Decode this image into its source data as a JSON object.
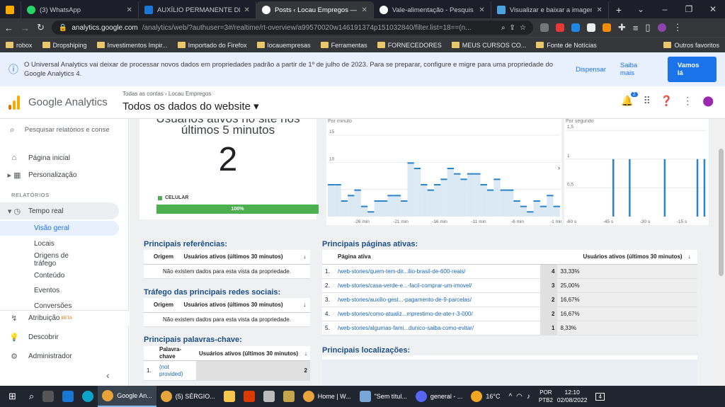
{
  "browser": {
    "tabs": [
      {
        "title": "",
        "color": "#f9ab00"
      },
      {
        "title": "(3) WhatsApp",
        "color": "#25d366"
      },
      {
        "title": "AUXÍLIO PERMANENTE DE...",
        "color": "#1976d2"
      },
      {
        "title": "Posts ‹ Locau Empregos —",
        "color": "#ffffff"
      },
      {
        "title": "Vale-alimentação - Pesquis",
        "color": "#ffffff"
      },
      {
        "title": "Visualizar e baixar a imagem",
        "color": "#4aa3df"
      }
    ],
    "new_tab": "+",
    "url_main": "analytics.google.com",
    "url_rest": "/analytics/web/?authuser=3#/realtime/rt-overview/a99570020w146191374p151032840/filter.list=18==(n...",
    "bookmarks": [
      "robox",
      "Dropshiping",
      "Investimentos Impir...",
      "Importado do Firefox",
      "locauempresas",
      "Ferramentas",
      "FORNECEDORES",
      "MEUS CURSOS CO...",
      "Fonte de Notícias"
    ],
    "bookmarks_other": "Outros favoritos"
  },
  "banner": {
    "message": "O Universal Analytics vai deixar de processar novos dados em propriedades padrão a partir de 1º de julho de 2023. Para se preparar, configure e migre para uma propriedade do Google Analytics 4.",
    "dismiss": "Dispensar",
    "learn_more": "Saiba mais",
    "go": "Vamos lá"
  },
  "header": {
    "app_title": "Google Analytics",
    "breadcrumb": "Todas as contas › Locau Empregos",
    "property": "Todos os dados do website ▾",
    "notifications": "2"
  },
  "sidebar": {
    "search_placeholder": "Pesquisar relatórios e conse",
    "home": "Página inicial",
    "custom": "Personalização",
    "reports_header": "RELATÓRIOS",
    "realtime": "Tempo real",
    "sub": [
      "Visão geral",
      "Locais",
      "Origens de tráfego",
      "Conteúdo",
      "Eventos",
      "Conversões"
    ],
    "attribution": "Atribuição",
    "beta": "BETA",
    "discover": "Descobrir",
    "admin": "Administrador",
    "collapse": "‹"
  },
  "overview": {
    "title_line1": "Usuários ativos no site nos",
    "title_line2": "últimos 5 minutos",
    "active_users": "2",
    "device": "CELULAR",
    "device_pct": "100%",
    "device_fraction": 1.0
  },
  "chart_data": [
    {
      "type": "bar",
      "title": "Por minuto",
      "ylim": [
        0,
        18
      ],
      "yticks": [
        "15",
        "10",
        "5"
      ],
      "xticks": [
        "-26 min",
        "-21 min",
        "-16 min",
        "-11 min",
        "-6 min",
        "-1 min"
      ],
      "values": [
        6,
        6,
        3,
        4,
        5,
        2,
        1,
        3,
        3,
        4,
        4,
        3,
        10,
        9,
        6,
        5,
        6,
        7,
        9,
        8,
        7,
        8,
        8,
        6,
        5,
        7,
        5,
        5,
        3,
        2,
        1,
        3,
        2,
        4,
        2
      ]
    },
    {
      "type": "bar",
      "title": "Por segundo",
      "ylim": [
        0,
        1.7
      ],
      "yticks": [
        "1,5",
        "1",
        "0,5"
      ],
      "xticks": [
        "-60 s",
        "-45 s",
        "-30 s",
        "-15 s"
      ],
      "values": [
        0,
        0,
        0,
        0,
        0,
        0,
        0,
        0,
        0,
        0,
        0,
        0,
        0,
        0,
        0,
        0,
        0,
        0,
        0,
        0,
        1,
        0,
        0,
        0,
        0,
        0,
        0,
        1,
        0,
        0,
        0,
        0,
        0,
        0,
        0,
        0,
        0,
        0,
        0,
        0,
        0,
        0,
        1,
        0,
        0,
        0,
        0,
        0,
        0,
        0,
        0,
        0,
        0,
        0,
        0,
        0,
        1,
        0,
        0,
        1
      ]
    }
  ],
  "referrals": {
    "title": "Principais referências:",
    "col1": "Origem",
    "col2": "Usuários ativos (últimos 30 minutos)",
    "empty": "Não existem dados para esta vista da propriedade."
  },
  "social": {
    "title": "Tráfego das principais redes sociais:",
    "col1": "Origem",
    "col2": "Usuários ativos (últimos 30 minutos)",
    "empty": "Não existem dados para esta vista da propriedade."
  },
  "keywords": {
    "title": "Principais palavras-chave:",
    "col1": "Palavra-chave",
    "col2": "Usuários ativos (últimos 30 minutos)",
    "rows": [
      {
        "n": "1.",
        "k": "(not provided)",
        "v": "2"
      }
    ]
  },
  "pages": {
    "title": "Principais páginas ativas:",
    "col1": "Página ativa",
    "col2": "Usuários ativos (últimos 30 minutos)",
    "rows": [
      {
        "n": "1.",
        "p": "/web-stories/quem-tem-dir...ilio-brasil-de-600-reais/",
        "v": "4",
        "pct": "33,33%"
      },
      {
        "n": "2.",
        "p": "/web-stories/casa-verde-e...-facil-comprar-um-imovel/",
        "v": "3",
        "pct": "25,00%"
      },
      {
        "n": "3.",
        "p": "/web-stories/auxilio-gest...-pagamento-de-9-parcelas/",
        "v": "2",
        "pct": "16,67%"
      },
      {
        "n": "4.",
        "p": "/web-stories/como-atualiz...mprestimo-de-ate-r-3-000/",
        "v": "2",
        "pct": "16,67%"
      },
      {
        "n": "5.",
        "p": "/web-stories/algumas-fami...dunico-saiba-como-evitar/",
        "v": "1",
        "pct": "8,33%"
      }
    ]
  },
  "locations": {
    "title": "Principais localizações:"
  },
  "taskbar": {
    "items": [
      "Google An...",
      "(5) SÉRGIO...",
      "",
      "",
      "",
      "",
      "Home | W...",
      "\"Sem títul...",
      "general - ..."
    ],
    "weather": "16°C",
    "lang1": "POR",
    "lang2": "PTB2",
    "time": "12:10",
    "date": "02/08/2022",
    "notif": "4"
  }
}
